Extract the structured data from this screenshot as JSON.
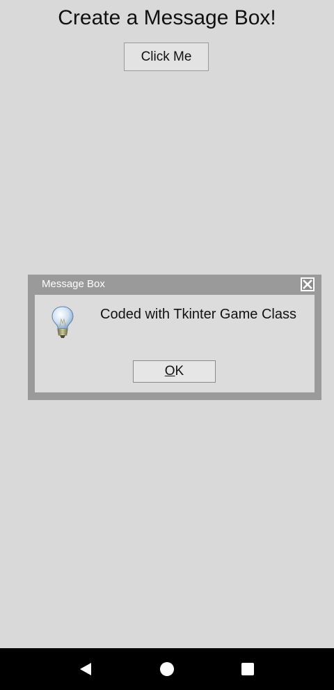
{
  "app": {
    "title": "Create a Message Box!",
    "button_label": "Click Me"
  },
  "dialog": {
    "title": "Message Box",
    "close_icon": "close-icon",
    "message_icon": "lightbulb-icon",
    "message": "Coded with Tkinter Game Class",
    "ok_mnemonic": "O",
    "ok_rest": "K"
  },
  "navbar": {
    "back_icon": "back-triangle-icon",
    "home_icon": "home-circle-icon",
    "recents_icon": "recents-square-icon",
    "icon_color": "#ffffff",
    "background": "#000000"
  },
  "colors": {
    "background": "#d9d9d9",
    "dialog_frame": "#9a9a9a",
    "dialog_body": "#dcdcdc"
  }
}
